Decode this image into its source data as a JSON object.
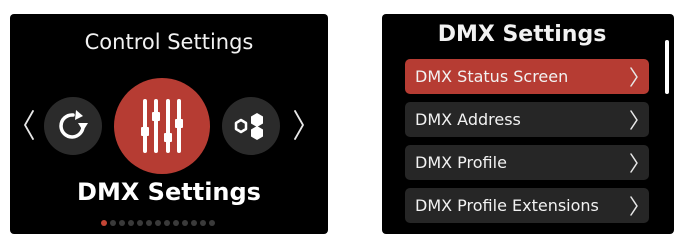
{
  "left_screen": {
    "title": "Control Settings",
    "carousel": {
      "items": [
        {
          "icon": "reset-icon"
        },
        {
          "icon": "dmx-sliders-icon",
          "selected": true
        },
        {
          "icon": "network-icon"
        }
      ],
      "selected_label": "DMX Settings",
      "page_count": 13,
      "active_page": 1
    }
  },
  "right_screen": {
    "title": "DMX Settings",
    "menu_items": [
      {
        "label": "DMX Status Screen",
        "selected": true
      },
      {
        "label": "DMX Address"
      },
      {
        "label": "DMX Profile"
      },
      {
        "label": "DMX Profile Extensions"
      }
    ]
  },
  "colors": {
    "accent": "#b63c33",
    "background": "#000000",
    "item_background": "#262626",
    "inactive_dot": "#3a3a3a"
  }
}
